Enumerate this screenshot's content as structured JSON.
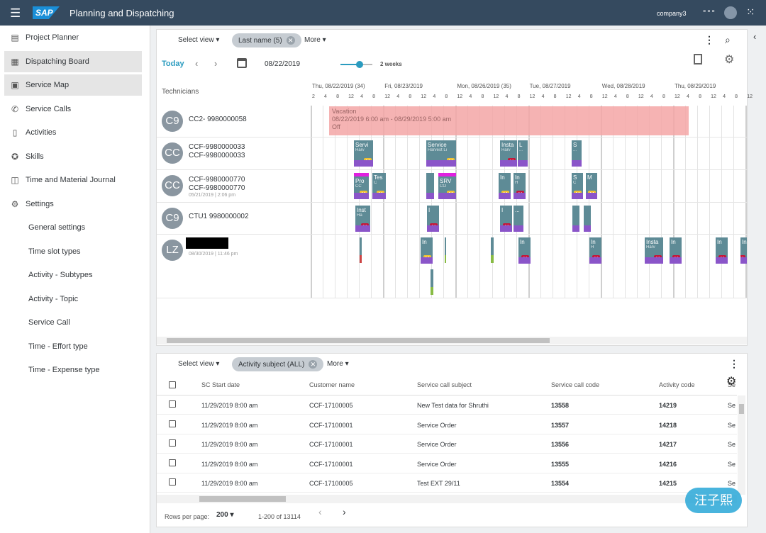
{
  "app": {
    "logo": "SAP",
    "title": "Planning and Dispatching",
    "company": "company3",
    "icons": [
      "menu-icon",
      "more-icon",
      "user-icon",
      "grid-icon"
    ]
  },
  "sidebar": {
    "items": [
      {
        "label": "Project Planner",
        "icon": "planner-icon"
      },
      {
        "label": "Dispatching Board",
        "icon": "board-icon",
        "selected": true
      },
      {
        "label": "Service Map",
        "icon": "map-icon",
        "selected": true
      },
      {
        "label": "Service Calls",
        "icon": "phone-icon"
      },
      {
        "label": "Activities",
        "icon": "clipboard-icon"
      },
      {
        "label": "Skills",
        "icon": "badge-icon"
      },
      {
        "label": "Time and Material Journal",
        "icon": "briefcase-icon"
      },
      {
        "label": "Settings",
        "icon": "gear-icon"
      },
      {
        "label": "General settings",
        "sub": true
      },
      {
        "label": "Time slot types",
        "sub": true
      },
      {
        "label": "Activity - Subtypes",
        "sub": true
      },
      {
        "label": "Activity - Topic",
        "sub": true
      },
      {
        "label": "Service Call",
        "sub": true
      },
      {
        "label": "Time - Effort type",
        "sub": true
      },
      {
        "label": "Time - Expense type",
        "sub": true
      }
    ]
  },
  "board": {
    "select_view": "Select view",
    "filter_chip": "Last name (5)",
    "more": "More",
    "today": "Today",
    "date": "08/22/2019",
    "zoom_label": "2 weeks",
    "zoom_value": 0.6,
    "technicians_label": "Technicians",
    "days": [
      "Thu, 08/22/2019 (34)",
      "Fri, 08/23/2019",
      "Mon, 08/26/2019 (35)",
      "Tue, 08/27/2019",
      "Wed, 08/28/2019",
      "Thu, 08/29/2019"
    ],
    "first_ticks": [
      "2",
      "4",
      "8",
      "12",
      "4",
      "8"
    ],
    "ticks": [
      "12",
      "4",
      "8",
      "12",
      "4",
      "8"
    ],
    "technicians": [
      {
        "initials": "C9",
        "line1": "CC2- 9980000058"
      },
      {
        "initials": "CC",
        "line1": "CCF-9980000033",
        "line2": "CCF-9980000033"
      },
      {
        "initials": "CC",
        "line1": "CCF-9980000770",
        "line2": "CCF-9980000770",
        "line3": "05/21/2019 | 2:06 pm"
      },
      {
        "initials": "C9",
        "line1": "CTU1 9980000002"
      },
      {
        "initials": "LZ",
        "line1": "",
        "line3": "08/30/2019 | 11:46 pm"
      }
    ],
    "vacation": {
      "title": "Vacation",
      "range": "08/22/2019 6:00 am - 08/29/2019 5:00 am",
      "status": "Off",
      "color": "#f4a6a6"
    },
    "events": [
      {
        "row": 1,
        "t": "Servi",
        "s": "Harv",
        "b": "M"
      },
      {
        "row": 1,
        "t": "Service",
        "s": "Harvest Li",
        "b": "M"
      },
      {
        "row": 1,
        "t": "Insta",
        "s": "Harv",
        "b": "H"
      },
      {
        "row": 1,
        "t": "L",
        "s": "..."
      },
      {
        "row": 1,
        "t": "S",
        "s": "..."
      },
      {
        "row": 2,
        "t": "Pro",
        "s": "CC",
        "b": "M",
        "top": "#e020e0"
      },
      {
        "row": 2,
        "t": "Tes",
        "s": "C",
        "b": "M"
      },
      {
        "row": 2,
        "t": ""
      },
      {
        "row": 2,
        "t": "SRV",
        "s": "CO",
        "b": "M",
        "top": "#e020e0"
      },
      {
        "row": 2,
        "t": "In",
        "b": "M"
      },
      {
        "row": 2,
        "t": "In",
        "s": "H",
        "b": "H"
      },
      {
        "row": 2,
        "t": "S",
        "s": "C",
        "b": "M"
      },
      {
        "row": 2,
        "t": "M",
        "b": "M"
      },
      {
        "row": 3,
        "t": "Inst",
        "s": "Ha",
        "b": "H"
      },
      {
        "row": 3,
        "t": "I",
        "b": "H"
      },
      {
        "row": 3,
        "t": "I",
        "b": "H"
      },
      {
        "row": 3,
        "t": "..."
      },
      {
        "row": 3,
        "t": ""
      },
      {
        "row": 3,
        "t": ""
      },
      {
        "row": 4,
        "t": "In",
        "b": "M"
      },
      {
        "row": 4,
        "t": "In",
        "b": "H"
      },
      {
        "row": 4,
        "t": "In",
        "s": "H",
        "b": "H"
      },
      {
        "row": 4,
        "t": "Insta",
        "s": "Harv",
        "b": "H"
      },
      {
        "row": 4,
        "t": "In",
        "b": "H"
      },
      {
        "row": 4,
        "t": "In",
        "b": "H"
      },
      {
        "row": 4,
        "t": "In",
        "b": "H"
      }
    ],
    "colors": {
      "event": "#5e8b96",
      "status_bar": "#8a55c9",
      "badge_M": "#f1c232",
      "badge_H": "#c4173a",
      "accent": "#2a9bbf"
    }
  },
  "list": {
    "select_view": "Select view",
    "filter_chip": "Activity subject (ALL)",
    "more": "More",
    "columns": [
      "SC Start date",
      "Customer name",
      "Service call subject",
      "Service call code",
      "Activity code",
      "Se"
    ],
    "rows": [
      [
        "11/29/2019 8:00 am",
        "CCF-17100005",
        "New Test data for Shruthi",
        "13558",
        "14219",
        "Se"
      ],
      [
        "11/29/2019 8:00 am",
        "CCF-17100001",
        "Service Order",
        "13557",
        "14218",
        "Se"
      ],
      [
        "11/29/2019 8:00 am",
        "CCF-17100001",
        "Service Order",
        "13556",
        "14217",
        "Se"
      ],
      [
        "11/29/2019 8:00 am",
        "CCF-17100001",
        "Service Order",
        "13555",
        "14216",
        "Se"
      ],
      [
        "11/29/2019 8:00 am",
        "CCF-17100005",
        "Test EXT 29/11",
        "13554",
        "14215",
        "Se"
      ]
    ],
    "rows_per_page_label": "Rows per page:",
    "rows_per_page": "200",
    "range": "1-200 of 13114"
  },
  "watermark": "汪子熙"
}
